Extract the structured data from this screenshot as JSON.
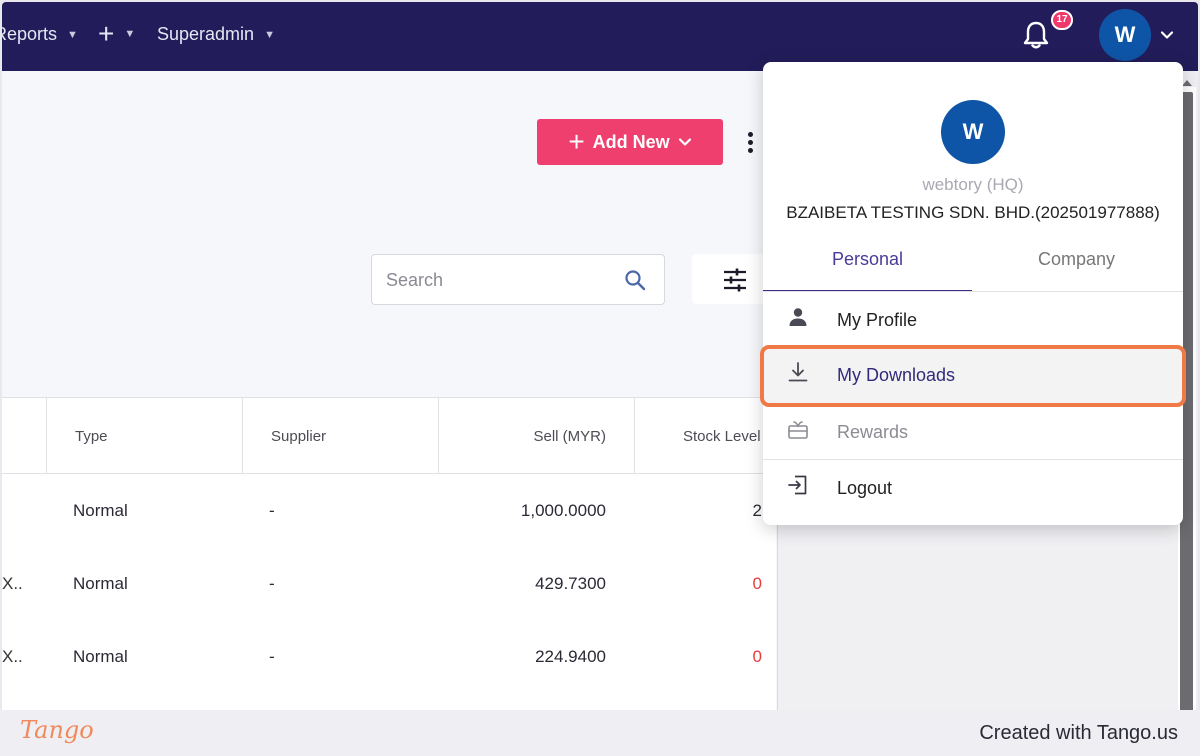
{
  "topnav": {
    "reports_label": "Reports",
    "add_label": "+",
    "superadmin_label": "Superadmin",
    "notification_count": "17",
    "avatar_initial": "W"
  },
  "toolbar": {
    "add_new_label": "Add New",
    "search_placeholder": "Search"
  },
  "table": {
    "columns": [
      "Type",
      "Supplier",
      "Sell (MYR)",
      "Stock Level"
    ],
    "rows": [
      {
        "lead": "",
        "type": "Normal",
        "supplier": "-",
        "sell": "1,000.0000",
        "stock": "2"
      },
      {
        "lead": "X...",
        "type": "Normal",
        "supplier": "-",
        "sell": "429.7300",
        "stock": "0"
      },
      {
        "lead": "X...",
        "type": "Normal",
        "supplier": "-",
        "sell": "224.9400",
        "stock": "0"
      }
    ]
  },
  "profile_menu": {
    "avatar_initial": "W",
    "org_name": "webtory (HQ)",
    "company_name": "BZAIBETA TESTING SDN. BHD.(202501977888)",
    "tabs": [
      "Personal",
      "Company"
    ],
    "items": [
      "My Profile",
      "My Downloads",
      "Rewards",
      "Logout"
    ],
    "item_icons": [
      "person-icon",
      "download-icon",
      "gift-icon",
      "logout-icon"
    ],
    "highlighted_item": "My Downloads"
  },
  "footer": {
    "logo": "Tango",
    "credit": "Created with Tango.us"
  },
  "colors": {
    "nav_bg": "#221d5a",
    "accent_pink": "#ee3f6e",
    "avatar_blue": "#0f55a7",
    "highlight_orange": "#f07a45",
    "tab_active": "#3d2d8e"
  }
}
